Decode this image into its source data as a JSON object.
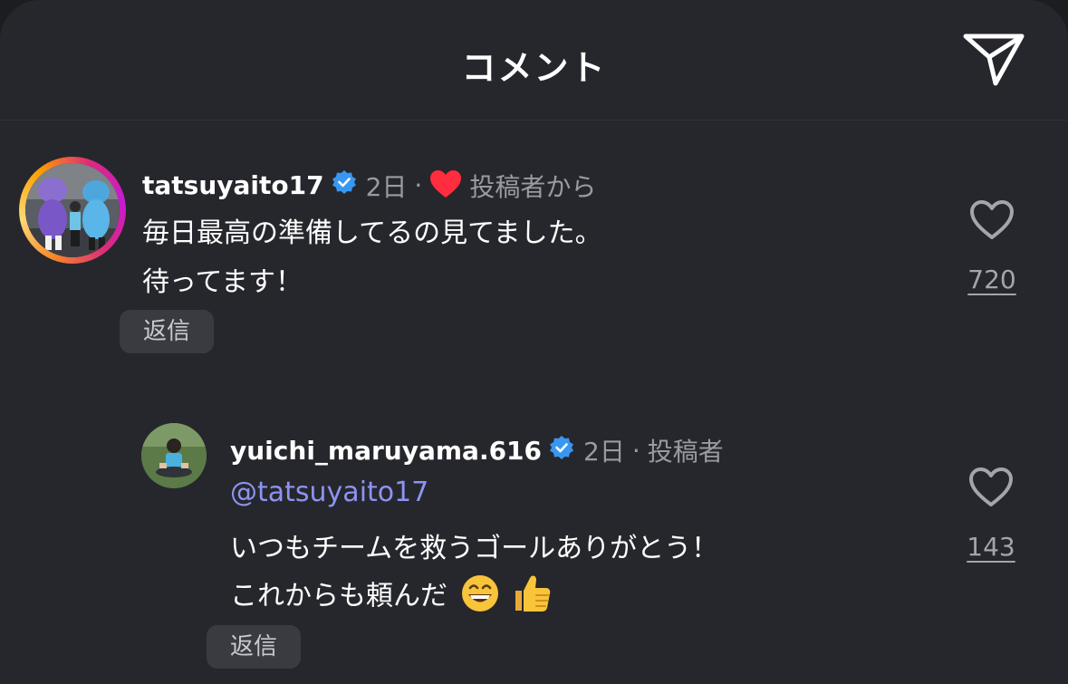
{
  "header": {
    "title": "コメント",
    "share_icon": "paper-plane-icon"
  },
  "comments": [
    {
      "username": "tatsuyaito17",
      "verified": true,
      "time": "2日",
      "separator": "·",
      "liked_by_author_label": "投稿者から",
      "lines": [
        "毎日最高の準備してるの見てました。",
        "待ってます！"
      ],
      "reply_label": "返信",
      "likes": "720"
    },
    {
      "username": "yuichi_maruyama.616",
      "verified": true,
      "time": "2日",
      "separator": "·",
      "author_label": "投稿者",
      "mention": "@tatsuyaito17",
      "lines": [
        "いつもチームを救うゴールありがとう！",
        "これからも頼んだ"
      ],
      "reply_label": "返信",
      "likes": "143"
    }
  ],
  "colors": {
    "background": "#26272c",
    "verified_blue": "#3897f0",
    "heart_red": "#ff2d3e",
    "mention": "#8e93f2"
  }
}
